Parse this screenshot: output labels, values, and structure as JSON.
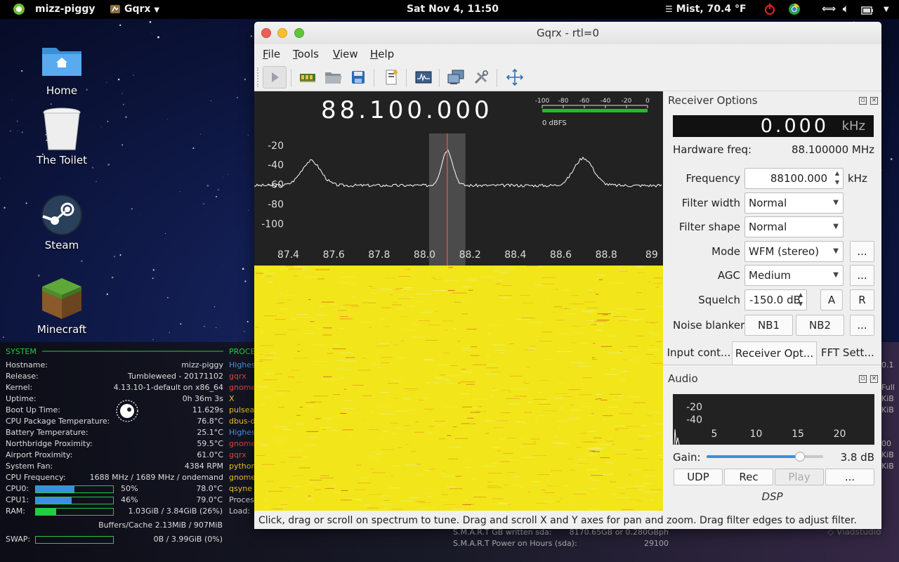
{
  "topbar": {
    "username": "mizz-piggy",
    "app_menu": "Gqrx",
    "clock": "Sat Nov  4, 11:50",
    "weather": "Mist, 70.4 °F"
  },
  "desktop_icons": [
    {
      "label": "Home",
      "icon": "folder-home-icon"
    },
    {
      "label": "The Toilet",
      "icon": "trash-icon"
    },
    {
      "label": "Steam",
      "icon": "steam-icon"
    },
    {
      "label": "Minecraft",
      "icon": "minecraft-icon"
    }
  ],
  "conky": {
    "system_header": "SYSTEM",
    "process_header": "PROCE",
    "rows": [
      {
        "k": "Hostname:",
        "v": "mizz-piggy"
      },
      {
        "k": "Release:",
        "v": "Tumbleweed - 20171102"
      },
      {
        "k": "Kernel:",
        "v": "4.13.10-1-default on x86_64"
      },
      {
        "k": "Uptime:",
        "v": "0h 36m 3s"
      },
      {
        "k": "Boot Up Time:",
        "v": "11.629s"
      },
      {
        "k": "CPU Package Temperature:",
        "v": "76.8°C"
      },
      {
        "k": "Battery Temperature:",
        "v": "25.1°C"
      },
      {
        "k": "Northbridge Proximity:",
        "v": "59.5°C"
      },
      {
        "k": "Airport Proximity:",
        "v": "61.0°C"
      },
      {
        "k": "System Fan:",
        "v": "4384 RPM"
      },
      {
        "k": "CPU Frequency:",
        "v": "1688 MHz / 1689 MHz / ondemand"
      }
    ],
    "cpu0": {
      "label": "CPU0:",
      "pct": "50%",
      "temp": "78.0°C",
      "level": 0.5
    },
    "cpu1": {
      "label": "CPU1:",
      "pct": "46%",
      "temp": "79.0°C",
      "level": 0.46
    },
    "ram": {
      "label": "RAM:",
      "value": "1.03GiB / 3.84GiB (26%)",
      "level": 0.26
    },
    "buffers": "Buffers/Cache 2.13MiB / 907MiB",
    "swap": {
      "label": "SWAP:",
      "value": "0B   / 3.99GiB (0%)",
      "level": 0
    },
    "processes": [
      {
        "name": "Highes",
        "color": "#4a90e2"
      },
      {
        "name": "gqrx",
        "color": "#e04040"
      },
      {
        "name": "gnome",
        "color": "#e04040"
      },
      {
        "name": "X",
        "color": "#e8c020"
      },
      {
        "name": "pulsea",
        "color": "#e8c020"
      },
      {
        "name": "dbus-d",
        "color": "#e8c020"
      },
      {
        "name": "Highes",
        "color": "#4a90e2"
      },
      {
        "name": "gnome",
        "color": "#e04040"
      },
      {
        "name": "gqrx",
        "color": "#e04040"
      },
      {
        "name": "python",
        "color": "#e8c020"
      },
      {
        "name": "gnome",
        "color": "#e8c020"
      },
      {
        "name": "qsyne",
        "color": "#e8c020"
      },
      {
        "name": "Proces",
        "color": "#cccccc"
      },
      {
        "name": "Load:",
        "color": "#cccccc"
      }
    ],
    "smart_written_label": "S.M.A.R.T GB written sda:",
    "smart_written_value": "8170.65GB or 0.280GBph",
    "smart_hours_label": "S.M.A.R.T Power on Hours (sda):",
    "smart_hours_value": "29100",
    "right_edge": [
      "0.1",
      "Full",
      "KiB",
      "KiB",
      "00",
      "KiB",
      "KiB"
    ],
    "watermark": "Vladstudio"
  },
  "window": {
    "title": "Gqrx  - rtl=0",
    "menus": [
      {
        "label": "File",
        "underline": "F",
        "rest": "ile"
      },
      {
        "label": "Tools",
        "underline": "T",
        "rest": "ools"
      },
      {
        "label": "View",
        "underline": "V",
        "rest": "iew"
      },
      {
        "label": "Help",
        "underline": "H",
        "rest": "elp"
      }
    ],
    "toolbar_icons": [
      "play-icon",
      "hardware-icon",
      "open-folder-icon",
      "save-icon",
      "remote-control-icon",
      "spectrum-icon",
      "network-icon",
      "tools-icon",
      "fullscreen-icon"
    ],
    "lo_freq": "88.100.000",
    "dbfs_label": "0 dBFS",
    "dbfs_ticks": [
      "-100",
      "-80",
      "-60",
      "-40",
      "-20",
      "0"
    ],
    "statusbar": "Click, drag or scroll on spectrum to tune. Drag and scroll X and Y axes for pan and zoom. Drag filter edges to adjust filter."
  },
  "chart_data": {
    "type": "line",
    "xlabel": "",
    "ylabel": "",
    "x_ticks": [
      "87.4",
      "87.6",
      "87.8",
      "88.0",
      "88.2",
      "88.4",
      "88.6",
      "88.8",
      "89"
    ],
    "y_ticks": [
      "-20",
      "-40",
      "-60",
      "-80",
      "-100"
    ],
    "xlim": [
      87.25,
      89.05
    ],
    "ylim": [
      -113,
      -8
    ],
    "peaks": [
      {
        "x": 87.5,
        "y": -36
      },
      {
        "x": 88.1,
        "y": -25
      },
      {
        "x": 88.7,
        "y": -33
      }
    ],
    "noise_floor": -61,
    "filter_center": 88.1,
    "filter_width": 0.16
  },
  "receiver_options": {
    "title": "Receiver Options",
    "offset_value": "0.000",
    "offset_unit": "kHz",
    "hw_freq_label": "Hardware freq:",
    "hw_freq_value": "88.100000 MHz",
    "frequency_label": "Frequency",
    "frequency_value": "88100.000",
    "frequency_unit": "kHz",
    "filter_width_label": "Filter width",
    "filter_width_value": "Normal",
    "filter_shape_label": "Filter shape",
    "filter_shape_value": "Normal",
    "mode_label": "Mode",
    "mode_value": "WFM (stereo)",
    "agc_label": "AGC",
    "agc_value": "Medium",
    "squelch_label": "Squelch",
    "squelch_value": "-150.0 dB",
    "squelch_a": "A",
    "squelch_r": "R",
    "noise_blanker_label": "Noise blanker",
    "nb1": "NB1",
    "nb2": "NB2",
    "more": "..."
  },
  "tabs": [
    "Input cont...",
    "Receiver Opt...",
    "FFT Sett..."
  ],
  "audio": {
    "title": "Audio",
    "y_ticks": [
      "-20",
      "-40"
    ],
    "x_ticks": [
      "5",
      "10",
      "15",
      "20"
    ],
    "gain_label": "Gain:",
    "gain_value": "3.8 dB",
    "gain_level": 0.8,
    "udp": "UDP",
    "rec": "Rec",
    "play": "Play",
    "more": "...",
    "dsp": "DSP"
  }
}
